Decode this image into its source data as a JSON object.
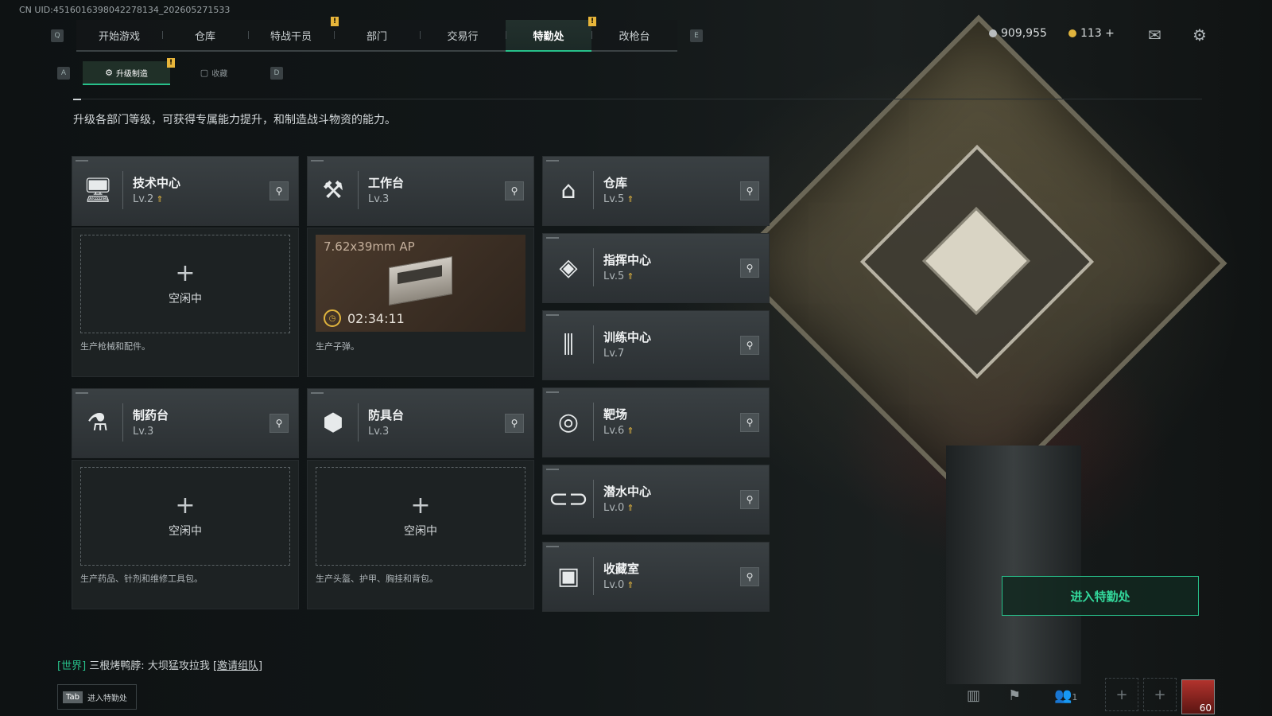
{
  "uid": "CN UID:4516016398042278134_202605271533",
  "top_tabs": [
    {
      "label": "开始游戏"
    },
    {
      "label": "仓库"
    },
    {
      "label": "特战干员",
      "badge": "!"
    },
    {
      "label": "部门"
    },
    {
      "label": "交易行"
    },
    {
      "label": "特勤处",
      "badge": "!",
      "active": true
    },
    {
      "label": "改枪台"
    }
  ],
  "keys": {
    "left": "Q",
    "right": "E",
    "sub_left": "A",
    "sub_right": "D"
  },
  "sub_tabs": [
    {
      "label": "升级制造",
      "active": true,
      "badge": "!"
    },
    {
      "label": "收藏"
    }
  ],
  "currency": {
    "silver": "909,955",
    "gold": "113 +"
  },
  "description": "升级各部门等级，可获得专属能力提升，和制造战斗物资的能力。",
  "left_cards": [
    {
      "name": "技术中心",
      "level": "Lv.2",
      "upgradable": true,
      "icon": "monitor-icon",
      "glyph": "🖥",
      "panel": {
        "state": "idle",
        "idle_label": "空闲中",
        "desc": "生产枪械和配件。"
      }
    },
    {
      "name": "工作台",
      "level": "Lv.3",
      "upgradable": false,
      "icon": "tools-icon",
      "glyph": "⚒",
      "panel": {
        "state": "crafting",
        "item": "7.62x39mm AP",
        "timer": "02:34:11",
        "desc": "生产子弹。"
      }
    },
    {
      "name": "制药台",
      "level": "Lv.3",
      "upgradable": false,
      "icon": "microscope-icon",
      "glyph": "⚗",
      "panel": {
        "state": "idle",
        "idle_label": "空闲中",
        "desc": "生产药品、针剂和维修工具包。"
      }
    },
    {
      "name": "防具台",
      "level": "Lv.3",
      "upgradable": false,
      "icon": "armor-blocks-icon",
      "glyph": "⬢",
      "panel": {
        "state": "idle",
        "idle_label": "空闲中",
        "desc": "生产头盔、护甲、胸挂和背包。"
      }
    }
  ],
  "right_cards": [
    {
      "name": "仓库",
      "level": "Lv.5",
      "upgradable": true,
      "icon": "warehouse-icon",
      "glyph": "⌂"
    },
    {
      "name": "指挥中心",
      "level": "Lv.5",
      "upgradable": true,
      "icon": "command-diamond-icon",
      "glyph": "◈"
    },
    {
      "name": "训练中心",
      "level": "Lv.7",
      "upgradable": false,
      "icon": "dumbbell-icon",
      "glyph": "⫼"
    },
    {
      "name": "靶场",
      "level": "Lv.6",
      "upgradable": true,
      "icon": "target-icon",
      "glyph": "◎"
    },
    {
      "name": "潜水中心",
      "level": "Lv.0",
      "upgradable": true,
      "icon": "diving-mask-icon",
      "glyph": "⊂⊃"
    },
    {
      "name": "收藏室",
      "level": "Lv.0",
      "upgradable": true,
      "icon": "collection-case-icon",
      "glyph": "▣"
    }
  ],
  "enter_button": "进入特勤处",
  "chat": {
    "channel": "[世界]",
    "sender": "三根烤鸭脖:",
    "message": "大坝猛攻拉我",
    "link": "[邀请组队]"
  },
  "tab_hint": {
    "key": "Tab",
    "label": "进入特勤处"
  },
  "squad_count": "1",
  "player_level": "60",
  "colors": {
    "accent": "#27c08a",
    "badge": "#e7b53a",
    "upgrade_arrow": "#e6b83f"
  }
}
